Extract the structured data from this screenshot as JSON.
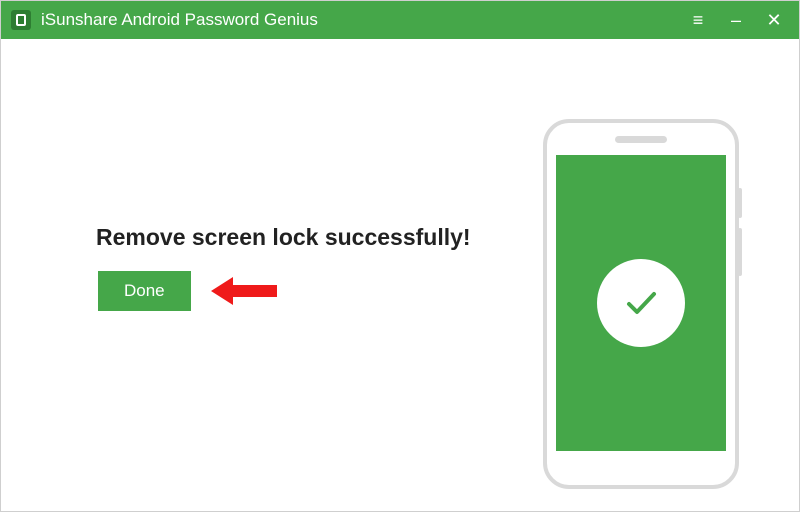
{
  "titlebar": {
    "title": "iSunshare Android Password Genius"
  },
  "main": {
    "message": "Remove screen lock successfully!",
    "done_label": "Done"
  },
  "colors": {
    "accent": "#45a749"
  }
}
